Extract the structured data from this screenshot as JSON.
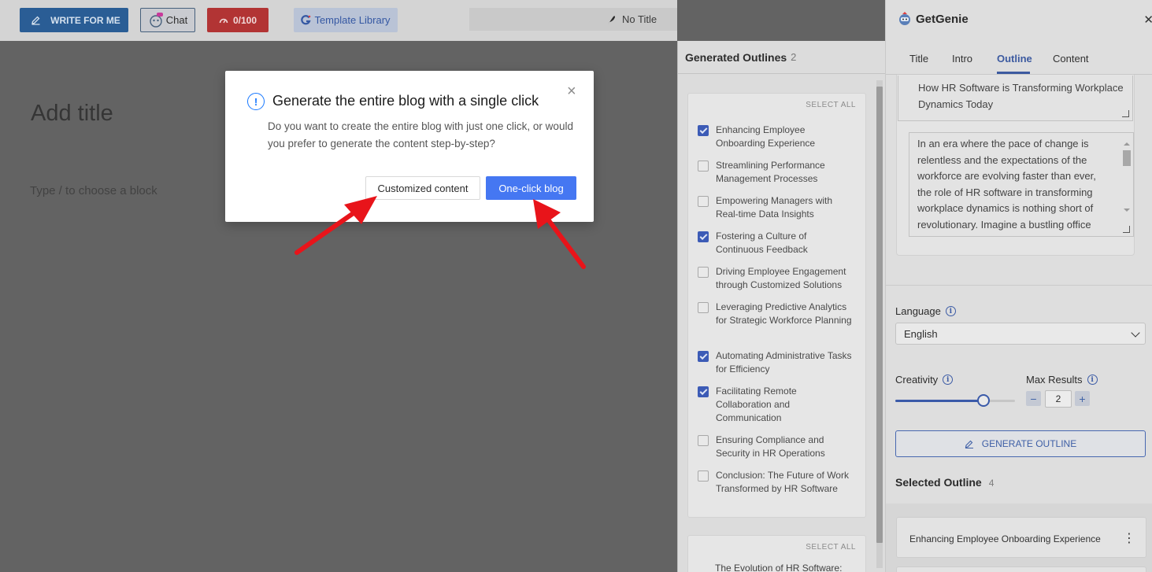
{
  "toolbar": {
    "write_label": "WRITE FOR ME",
    "chat_label": "Chat",
    "credits": "0/100",
    "template_label": "Template Library",
    "doc_title": "No Title"
  },
  "editor": {
    "title_placeholder": "Add title",
    "block_hint": "Type / to choose a block"
  },
  "outlines": {
    "heading": "Generated Outlines",
    "count": "2",
    "select_all": "SELECT ALL",
    "items": [
      {
        "label": "Enhancing Employee Onboarding Experience",
        "checked": true
      },
      {
        "label": "Streamlining Performance Management Processes",
        "checked": false
      },
      {
        "label": "Empowering Managers with Real-time Data Insights",
        "checked": false
      },
      {
        "label": "Fostering a Culture of Continuous Feedback",
        "checked": true
      },
      {
        "label": "Driving Employee Engagement through Customized Solutions",
        "checked": false
      },
      {
        "label": "Leveraging Predictive Analytics for Strategic Workforce Planning",
        "checked": false
      },
      {
        "label": "Automating Administrative Tasks for Efficiency",
        "checked": true
      },
      {
        "label": "Facilitating Remote Collaboration and Communication",
        "checked": true
      },
      {
        "label": "Ensuring Compliance and Security in HR Operations",
        "checked": false
      },
      {
        "label": "Conclusion: The Future of Work Transformed by HR Software",
        "checked": false
      }
    ],
    "second_select_all": "SELECT ALL",
    "second_first_item": "The Evolution of HR Software:"
  },
  "sidebar": {
    "brand": "GetGenie",
    "tabs": [
      "Title",
      "Intro",
      "Outline",
      "Content"
    ],
    "active_tab": "Outline",
    "title_text": "How HR Software is Transforming Workplace Dynamics Today",
    "intro_text": "In an era where the pace of change is relentless and the expectations of the workforce are evolving faster than ever, the role of HR software in transforming workplace dynamics is nothing short of revolutionary. Imagine a bustling office",
    "language_label": "Language",
    "language_value": "English",
    "creativity_label": "Creativity",
    "creativity_level": 0.74,
    "max_results_label": "Max Results",
    "max_results_value": "2",
    "minus": "−",
    "plus": "+",
    "generate_label": "GENERATE OUTLINE",
    "selected_heading": "Selected Outline",
    "selected_count": "4",
    "selected_first": "Enhancing Employee Onboarding Experience"
  },
  "modal": {
    "title": "Generate the entire blog with a single click",
    "body": "Do you want to create the entire blog with just one click, or would you prefer to generate the content step-by-step?",
    "custom_label": "Customized content",
    "oneclick_label": "One-click blog",
    "close_glyph": "×"
  },
  "colors": {
    "accent": "#3c5aa0",
    "primary_button": "#4577f2",
    "annotation_arrow": "#e8141a"
  }
}
